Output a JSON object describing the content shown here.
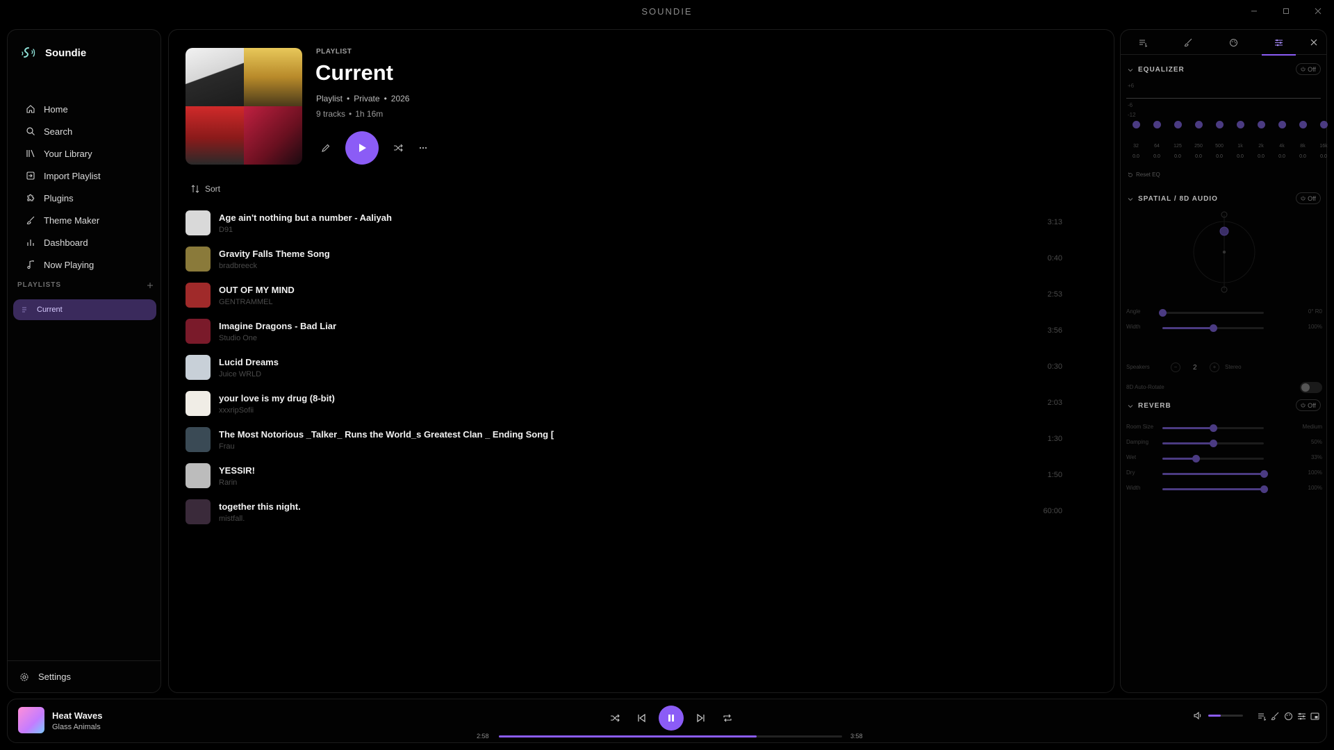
{
  "window": {
    "title": "SOUNDIE"
  },
  "sidebar": {
    "app_name": "Soundie",
    "nav": [
      {
        "label": "Home",
        "icon": "home-icon"
      },
      {
        "label": "Search",
        "icon": "search-icon"
      },
      {
        "label": "Your Library",
        "icon": "library-icon"
      },
      {
        "label": "Import Playlist",
        "icon": "import-icon"
      },
      {
        "label": "Plugins",
        "icon": "puzzle-icon"
      },
      {
        "label": "Theme Maker",
        "icon": "brush-icon"
      },
      {
        "label": "Dashboard",
        "icon": "chart-icon"
      },
      {
        "label": "Now Playing",
        "icon": "music-note-icon"
      }
    ],
    "playlists_heading": "PLAYLISTS",
    "playlists": [
      {
        "label": "Current"
      }
    ],
    "settings_label": "Settings"
  },
  "playlist": {
    "type_label": "PLAYLIST",
    "title": "Current",
    "meta": [
      "Playlist",
      "Private",
      "2026"
    ],
    "track_count": "9 tracks",
    "duration": "1h 16m",
    "sort_label": "Sort",
    "tracks": [
      {
        "title": "Age ain't nothing but a number - Aaliyah",
        "artist": "D91",
        "duration": "3:13",
        "thumb": "#d9d9d9"
      },
      {
        "title": "Gravity Falls Theme Song",
        "artist": "bradbreeck",
        "duration": "0:40",
        "thumb": "#8a7a3a"
      },
      {
        "title": "OUT OF MY MIND",
        "artist": "GENTRAMMEL",
        "duration": "2:53",
        "thumb": "#a02a2a"
      },
      {
        "title": "Imagine Dragons - Bad Liar",
        "artist": "Studio One",
        "duration": "3:56",
        "thumb": "#7a1a2a"
      },
      {
        "title": "Lucid Dreams",
        "artist": "Juice WRLD",
        "duration": "0:30",
        "thumb": "#c8d0d8"
      },
      {
        "title": "your love is my drug (8-bit)",
        "artist": "xxxripSofii",
        "duration": "2:03",
        "thumb": "#f0ede6"
      },
      {
        "title": "The Most Notorious _Talker_ Runs the World_s Greatest Clan _ Ending Song [",
        "artist": "Frau",
        "duration": "1:30",
        "thumb": "#3a4a55"
      },
      {
        "title": "YESSIR!",
        "artist": "Rarin",
        "duration": "1:50",
        "thumb": "#bcbcbc"
      },
      {
        "title": "together this night.",
        "artist": "mistfall.",
        "duration": "60:00",
        "thumb": "#3a2a3a"
      }
    ]
  },
  "effects": {
    "equalizer": {
      "title": "EQUALIZER",
      "toggle": "Off",
      "db_labels": [
        "+6",
        "-6",
        "-12"
      ],
      "bands": [
        {
          "freq": "32",
          "value": "0.0"
        },
        {
          "freq": "64",
          "value": "0.0"
        },
        {
          "freq": "125",
          "value": "0.0"
        },
        {
          "freq": "250",
          "value": "0.0"
        },
        {
          "freq": "500",
          "value": "0.0"
        },
        {
          "freq": "1k",
          "value": "0.0"
        },
        {
          "freq": "2k",
          "value": "0.0"
        },
        {
          "freq": "4k",
          "value": "0.0"
        },
        {
          "freq": "8k",
          "value": "0.0"
        },
        {
          "freq": "16k",
          "value": "0.0"
        }
      ],
      "reset_label": "Reset EQ"
    },
    "spatial": {
      "title": "SPATIAL / 8D AUDIO",
      "toggle": "Off",
      "sliders": [
        {
          "label": "Angle",
          "value": "0° R0",
          "level": 0.0
        },
        {
          "label": "Width",
          "value": "100%",
          "level": 0.5
        }
      ],
      "speakers_label": "Speakers",
      "speakers_value": "2",
      "speakers_mode": "Stereo",
      "auto_rotate_label": "8D Auto-Rotate"
    },
    "reverb": {
      "title": "REVERB",
      "toggle": "Off",
      "sliders": [
        {
          "label": "Room Size",
          "value": "Medium",
          "level": 0.5
        },
        {
          "label": "Damping",
          "value": "50%",
          "level": 0.5
        },
        {
          "label": "Wet",
          "value": "33%",
          "level": 0.33
        },
        {
          "label": "Dry",
          "value": "100%",
          "level": 1.0
        },
        {
          "label": "Width",
          "value": "100%",
          "level": 1.0
        }
      ]
    }
  },
  "player": {
    "title": "Heat Waves",
    "artist": "Glass Animals",
    "elapsed": "2:58",
    "total": "3:58",
    "progress": 0.75,
    "volume": 0.35
  },
  "colors": {
    "accent": "#8b5cf6",
    "background": "#000000"
  }
}
